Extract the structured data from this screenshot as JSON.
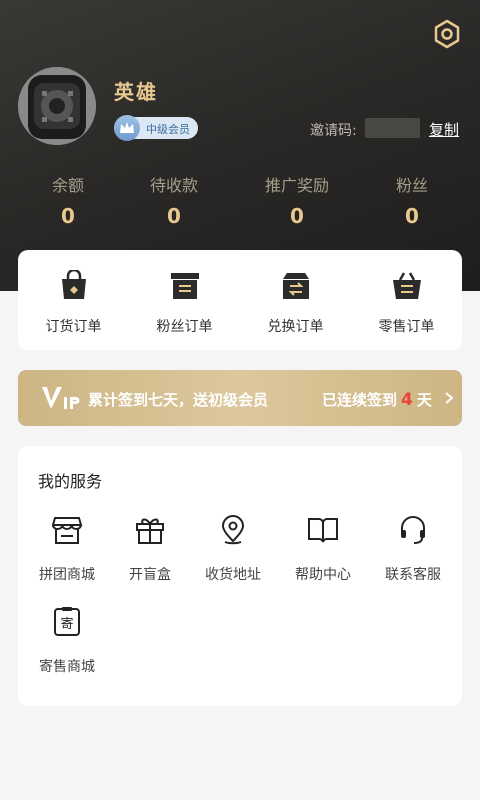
{
  "profile": {
    "username": "英雄",
    "level_label": "中级会员",
    "invite_label": "邀请码:",
    "invite_code": "",
    "copy_label": "复制"
  },
  "stats": [
    {
      "label": "余额",
      "value": "0"
    },
    {
      "label": "待收款",
      "value": "0"
    },
    {
      "label": "推广奖励",
      "value": "0"
    },
    {
      "label": "粉丝",
      "value": "0"
    }
  ],
  "orders": [
    {
      "label": "订货订单",
      "icon": "bag-icon"
    },
    {
      "label": "粉丝订单",
      "icon": "box-icon"
    },
    {
      "label": "兑换订单",
      "icon": "exchange-box-icon"
    },
    {
      "label": "零售订单",
      "icon": "basket-icon"
    }
  ],
  "vip_banner": {
    "text": "累计签到七天，送初级会员",
    "right_prefix": "已连续签到",
    "days": "4",
    "right_suffix": "天"
  },
  "services": {
    "title": "我的服务",
    "items": [
      {
        "label": "拼团商城",
        "icon": "store-icon"
      },
      {
        "label": "开盲盒",
        "icon": "gift-box-icon"
      },
      {
        "label": "收货地址",
        "icon": "location-pin-icon"
      },
      {
        "label": "帮助中心",
        "icon": "book-icon"
      },
      {
        "label": "联系客服",
        "icon": "headset-icon"
      },
      {
        "label": "寄售商城",
        "icon": "consign-icon"
      }
    ]
  },
  "colors": {
    "gold": "#e7c98f",
    "header_dark": "#2a2826",
    "banner_gold": "#cdb584",
    "days_red": "#e8443a"
  }
}
